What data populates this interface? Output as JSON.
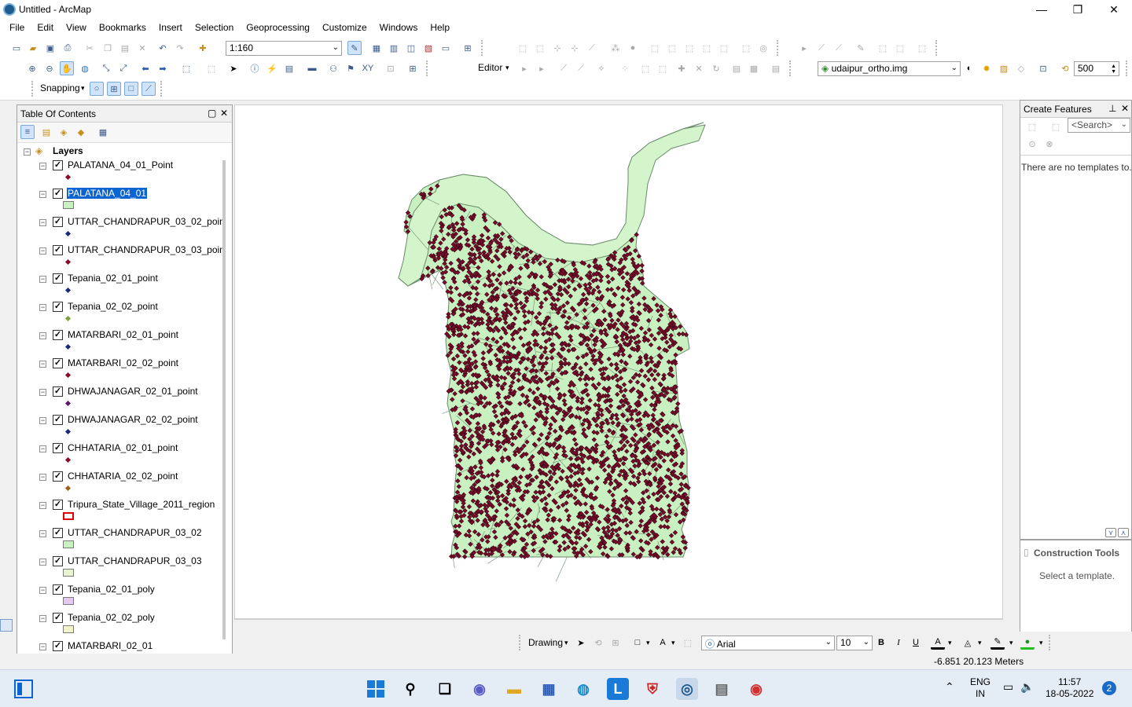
{
  "window": {
    "title": "Untitled - ArcMap",
    "minimize": "—",
    "maximize": "❐",
    "close": "✕"
  },
  "menu": [
    "File",
    "Edit",
    "View",
    "Bookmarks",
    "Insert",
    "Selection",
    "Geoprocessing",
    "Customize",
    "Windows",
    "Help"
  ],
  "toolbar": {
    "scale_value": "1:160",
    "editor_label": "Editor",
    "editor_arrow": "▾",
    "raster_layer": "udaipur_ortho.img",
    "stretch_value": "500",
    "snapping_label": "Snapping"
  },
  "toc": {
    "title": "Table Of Contents",
    "root_label": "Layers",
    "layers": [
      {
        "name": "PALATANA_04_01_Point",
        "symbol": "point",
        "color": "#8b0a2a",
        "selected": false
      },
      {
        "name": "PALATANA_04_01",
        "symbol": "poly",
        "color": "#c8f0c0",
        "selected": true
      },
      {
        "name": "UTTAR_CHANDRAPUR_03_02_point",
        "symbol": "point",
        "color": "#1a2a7a",
        "selected": false
      },
      {
        "name": "UTTAR_CHANDRAPUR_03_03_point",
        "symbol": "point",
        "color": "#8b0a2a",
        "selected": false
      },
      {
        "name": "Tepania_02_01_point",
        "symbol": "point",
        "color": "#1a2a7a",
        "selected": false
      },
      {
        "name": "Tepania_02_02_point",
        "symbol": "point",
        "color": "#7aa040",
        "selected": false
      },
      {
        "name": "MATARBARI_02_01_point",
        "symbol": "point",
        "color": "#1a2a7a",
        "selected": false
      },
      {
        "name": "MATARBARI_02_02_point",
        "symbol": "point",
        "color": "#8b0a2a",
        "selected": false
      },
      {
        "name": "DHWAJANAGAR_02_01_point",
        "symbol": "point",
        "color": "#5a1a6a",
        "selected": false
      },
      {
        "name": "DHWAJANAGAR_02_02_point",
        "symbol": "point",
        "color": "#1a2a7a",
        "selected": false
      },
      {
        "name": "CHHATARIA_02_01_point",
        "symbol": "point",
        "color": "#8b0a2a",
        "selected": false
      },
      {
        "name": "CHHATARIA_02_02_point",
        "symbol": "point",
        "color": "#a0601a",
        "selected": false
      },
      {
        "name": "Tripura_State_Village_2011_region",
        "symbol": "outline",
        "color": "#e00000",
        "selected": false
      },
      {
        "name": "UTTAR_CHANDRAPUR_03_02",
        "symbol": "poly",
        "color": "#c8f0c0",
        "selected": false
      },
      {
        "name": "UTTAR_CHANDRAPUR_03_03",
        "symbol": "poly",
        "color": "#e8f4d0",
        "selected": false
      },
      {
        "name": "Tepania_02_01_poly",
        "symbol": "poly",
        "color": "#e4c8f0",
        "selected": false
      },
      {
        "name": "Tepania_02_02_poly",
        "symbol": "poly",
        "color": "#f0f4c8",
        "selected": false
      },
      {
        "name": "MATARBARI_02_01",
        "symbol": "poly",
        "color": "#d0f0e0",
        "selected": false
      }
    ]
  },
  "create_features": {
    "title": "Create Features",
    "search_placeholder": "<Search>",
    "empty_text": "There are no templates to..."
  },
  "construction_tools": {
    "title": "Construction Tools",
    "hint": "Select a template."
  },
  "drawing_toolbar": {
    "label": "Drawing",
    "font_name": "Arial",
    "font_size": "10",
    "bold": "B",
    "italic": "I",
    "underline": "U",
    "text_tool": "A"
  },
  "status": {
    "coordinates": "-6.851  20.123 Meters"
  },
  "taskbar": {
    "lang_top": "ENG",
    "lang_bottom": "IN",
    "time": "11:57",
    "date": "18-05-2022",
    "notifications": "2"
  },
  "colors": {
    "parcel_fill": "#c8f0c0",
    "point_fill": "#7a0a2a",
    "selection_blue": "#0a64d2"
  }
}
